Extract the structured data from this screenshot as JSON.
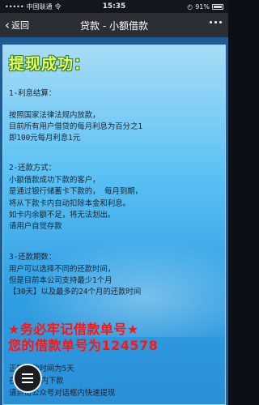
{
  "status_bar": {
    "carrier": "中国联通",
    "network": "令",
    "time": "15:35",
    "battery": "91%"
  },
  "nav_bar": {
    "back_label": "返回",
    "title": "贷款 - 小额借款"
  },
  "content": {
    "headline": "提现成功：",
    "section1": {
      "heading": "1-利息结算：",
      "lines": [
        "按照国家法律法规内放款，",
        "目前所有用户借贷的每月利息为百分之1",
        "即100元每月利息1元"
      ]
    },
    "section2": {
      "heading": "2-还款方式：",
      "lines": [
        "小额借款成功下款的客户，",
        "是通过银行储蓄卡下款的， 每月到期，",
        "将从下款卡内自动扣除本金和利息。",
        "如卡内余额不足，将无法划出。",
        "请用户自觉存款"
      ]
    },
    "section3": {
      "heading": "3-还款期数：",
      "lines": [
        "用户可以选择不同的还款时间，",
        "但是目前本公司支持最少1个月",
        "【30天】以及最多的24个月的还款时间"
      ]
    },
    "warning1": "★务必牢记借款单号★",
    "warning2": "您的借款单号为124578",
    "bottom_lines": [
      "正常下款时间为5天",
      "在30分之内下款",
      "请点击公众号对话框内快速提现"
    ]
  }
}
